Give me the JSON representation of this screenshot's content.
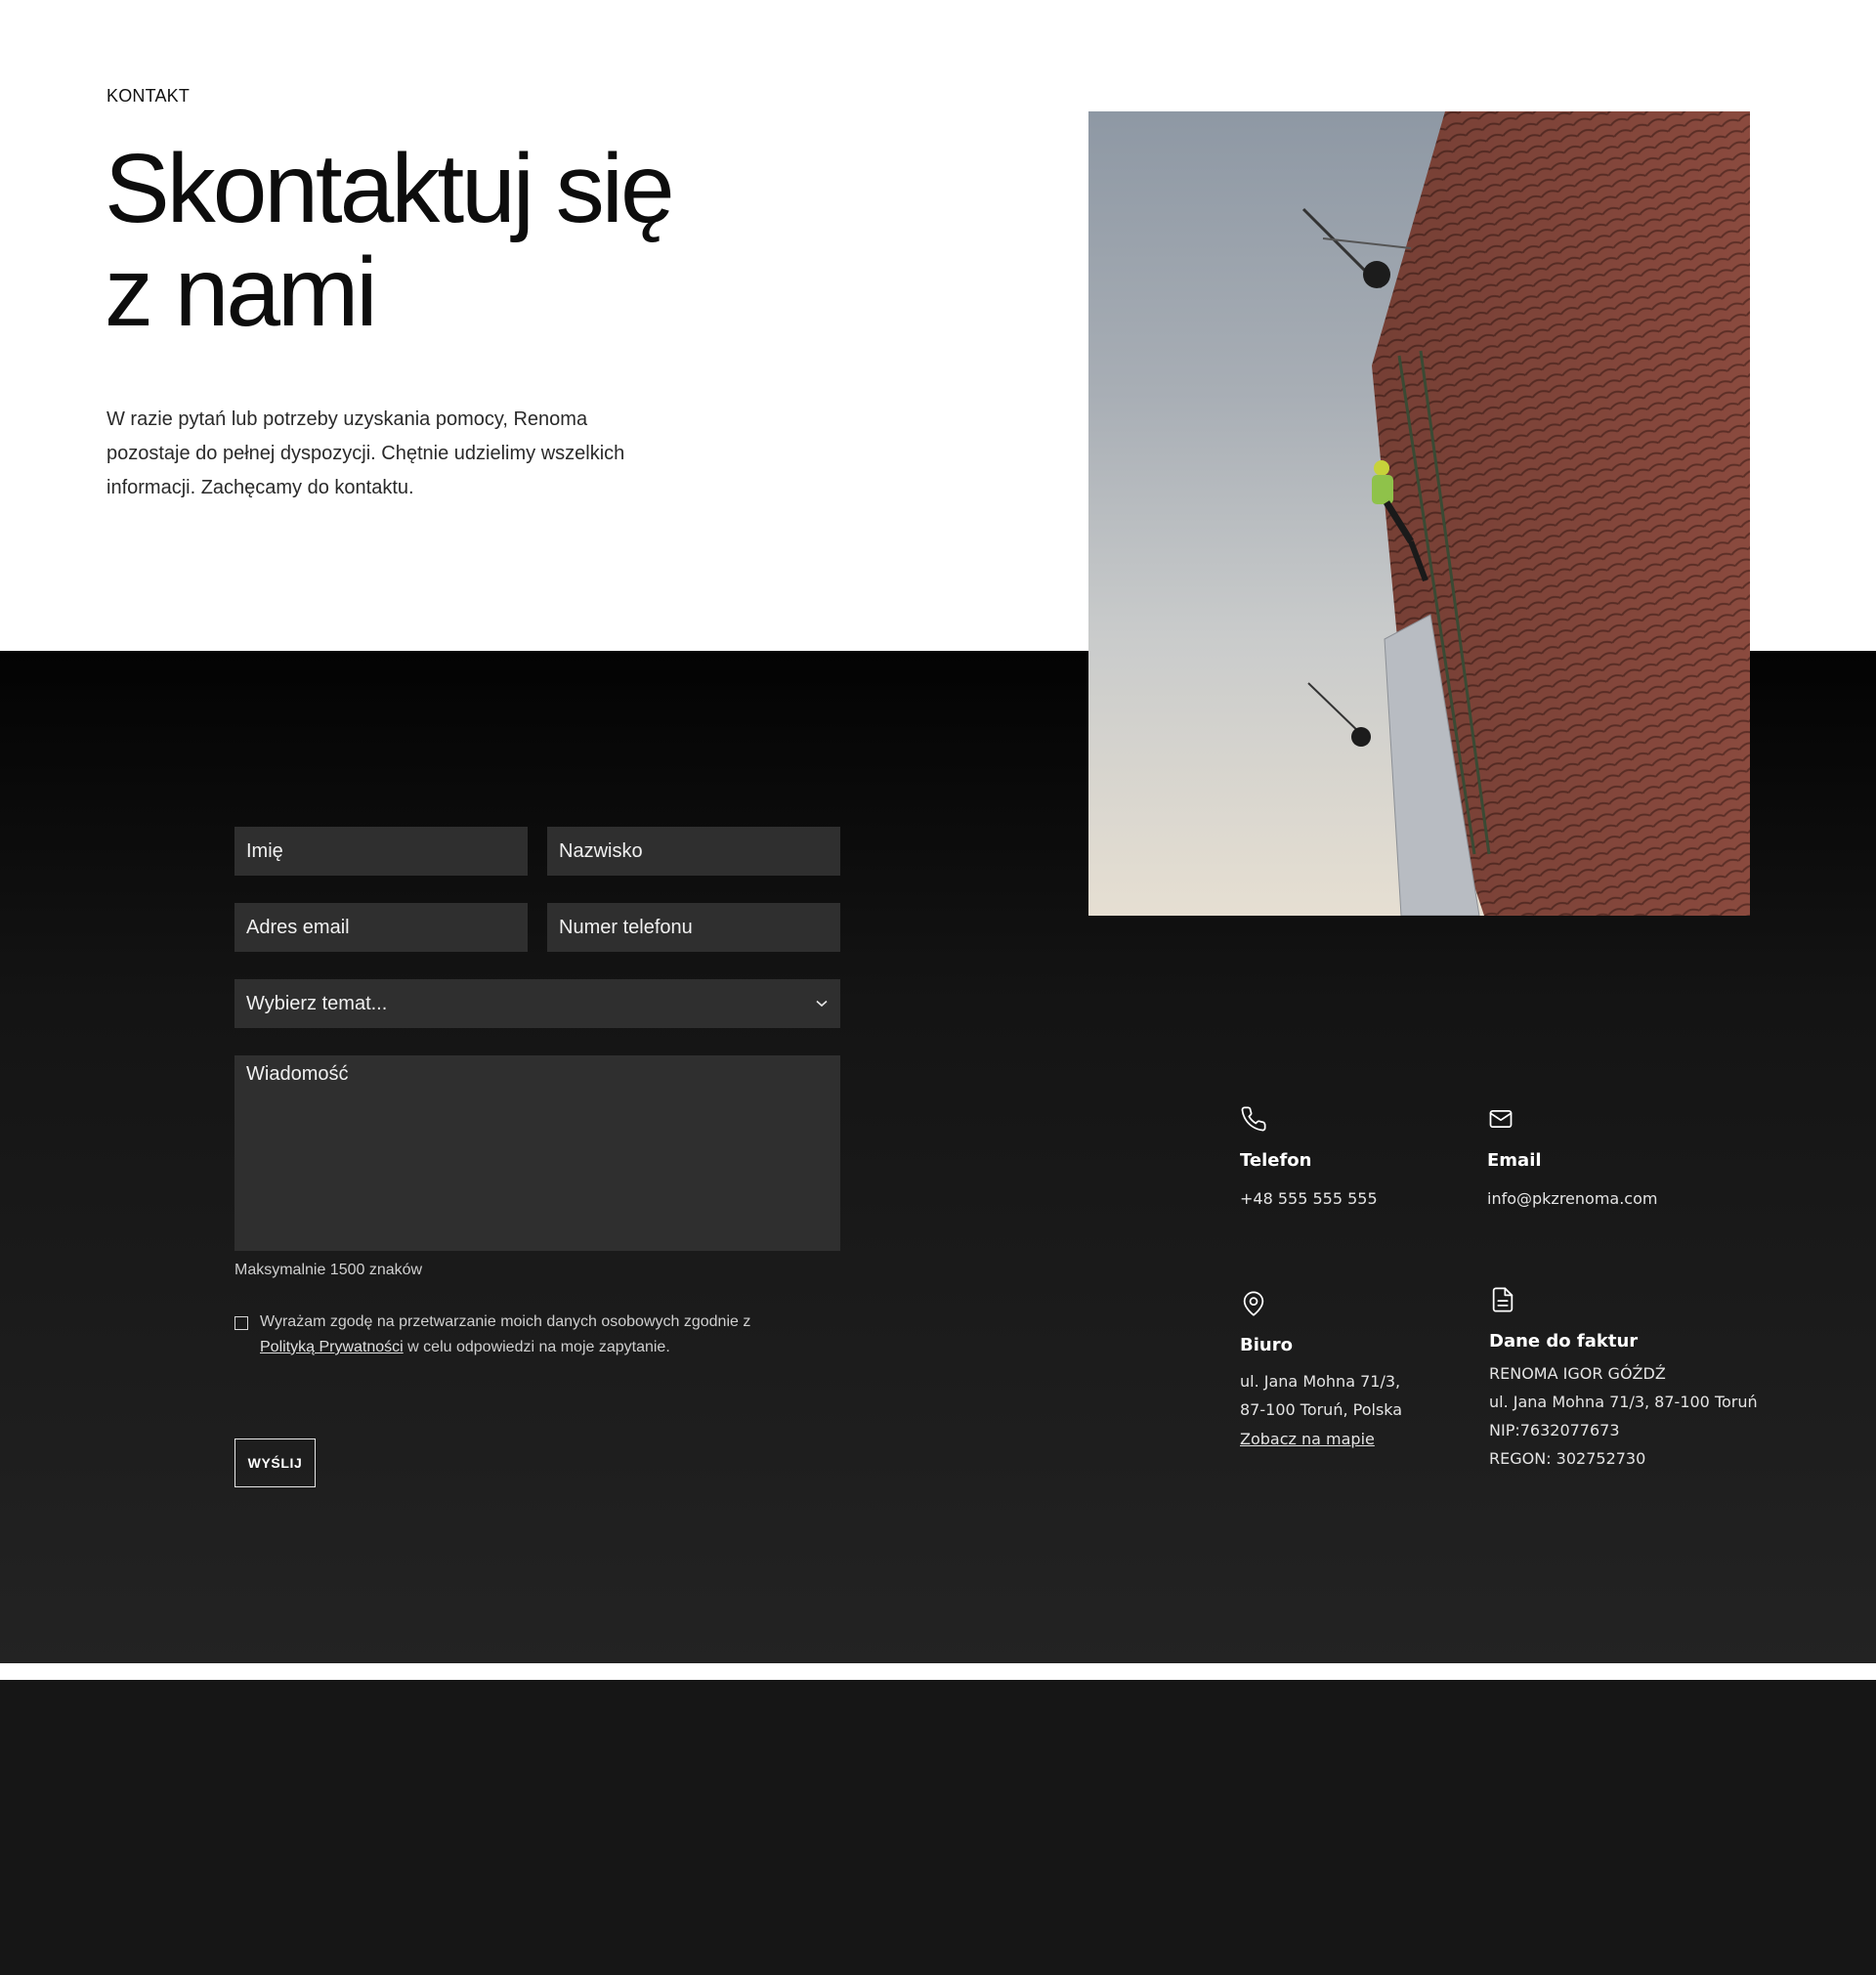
{
  "hero": {
    "eyebrow": "KONTAKT",
    "title_line1": "Skontaktuj się",
    "title_line2": "z nami",
    "intro": "W razie pytań lub potrzeby uzyskania pomocy, Renoma pozostaje do pełnej dyspozycji. Chętnie udzielimy wszelkich informacji. Zachęcamy do kontaktu."
  },
  "form": {
    "first_name_placeholder": "Imię",
    "last_name_placeholder": "Nazwisko",
    "email_placeholder": "Adres email",
    "phone_placeholder": "Numer telefonu",
    "topic_selected": "Wybierz temat...",
    "message_placeholder": "Wiadomość",
    "max_note": "Maksymalnie 1500 znaków",
    "consent_before": "Wyrażam zgodę na przetwarzanie moich danych osobowych zgodnie z",
    "consent_link": "Polityką Prywatności",
    "consent_after": "w celu odpowiedzi na moje zapytanie.",
    "submit_label": "WYŚLIJ"
  },
  "contact": {
    "phone": {
      "title": "Telefon",
      "value": "+48 555 555 555",
      "icon": "phone-icon"
    },
    "email": {
      "title": "Email",
      "value": "info@pkzrenoma.com",
      "icon": "mail-icon"
    },
    "office": {
      "title": "Biuro",
      "address_line1": "ul. Jana Mohna 71/3,",
      "address_line2": "87-100 Toruń, Polska",
      "map_link": "Zobacz na mapie",
      "icon": "map-pin-icon"
    },
    "invoice": {
      "title": "Dane do faktur",
      "line1": "RENOMA IGOR GÓŹDŹ",
      "line2": "ul. Jana Mohna 71/3, 87-100 Toruń",
      "line3": "NIP:7632077673",
      "line4": "REGON: 302752730",
      "icon": "document-icon"
    }
  },
  "colors": {
    "dark_bg": "#141414",
    "field_bg": "#2f2f2f",
    "text_dark": "#0d0d0d",
    "text_light": "#ffffff"
  }
}
